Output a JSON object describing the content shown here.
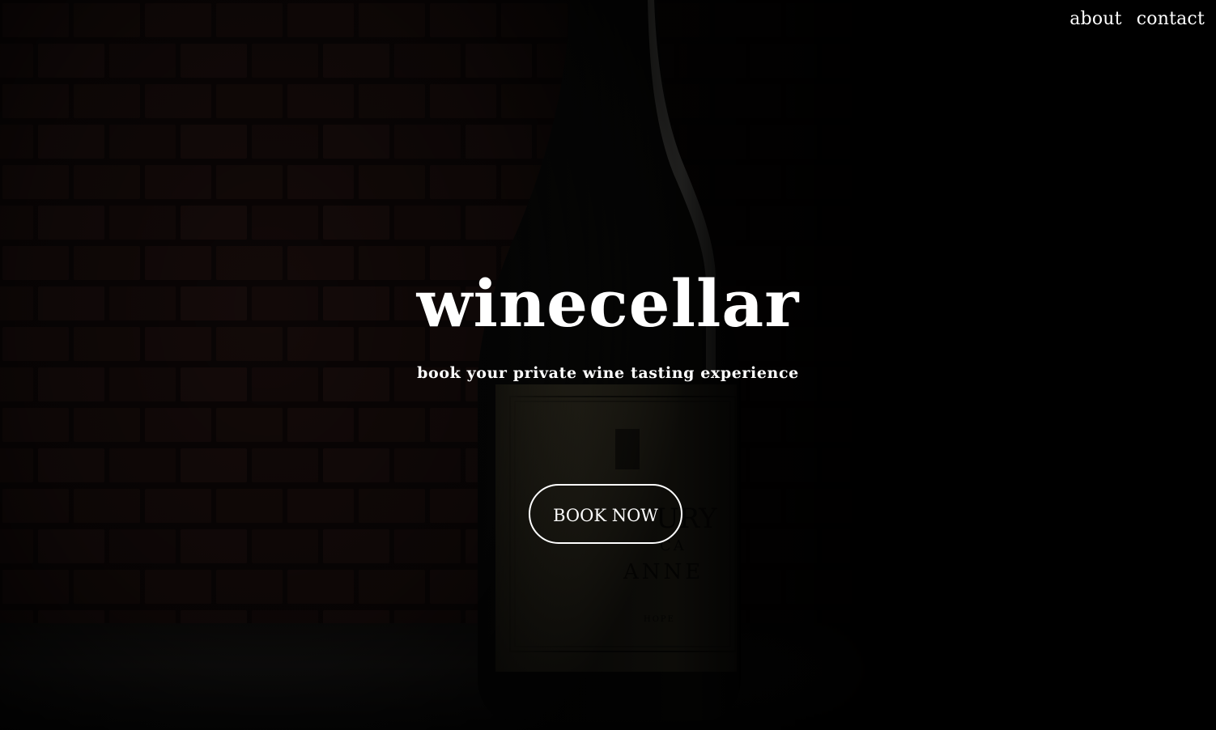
{
  "nav": {
    "about_label": "about",
    "contact_label": "contact"
  },
  "hero": {
    "title": "winecellar",
    "subtitle": "book your private wine tasting experience",
    "book_label": "BOOK NOW"
  },
  "background": {
    "subject": "wine bottle in front of a dark brick wall",
    "label_lines": [
      "URY",
      "CA",
      "ANNE",
      "HOPE"
    ]
  },
  "colors": {
    "background": "#000000",
    "text": "#ffffff",
    "label": "#4a4430"
  }
}
